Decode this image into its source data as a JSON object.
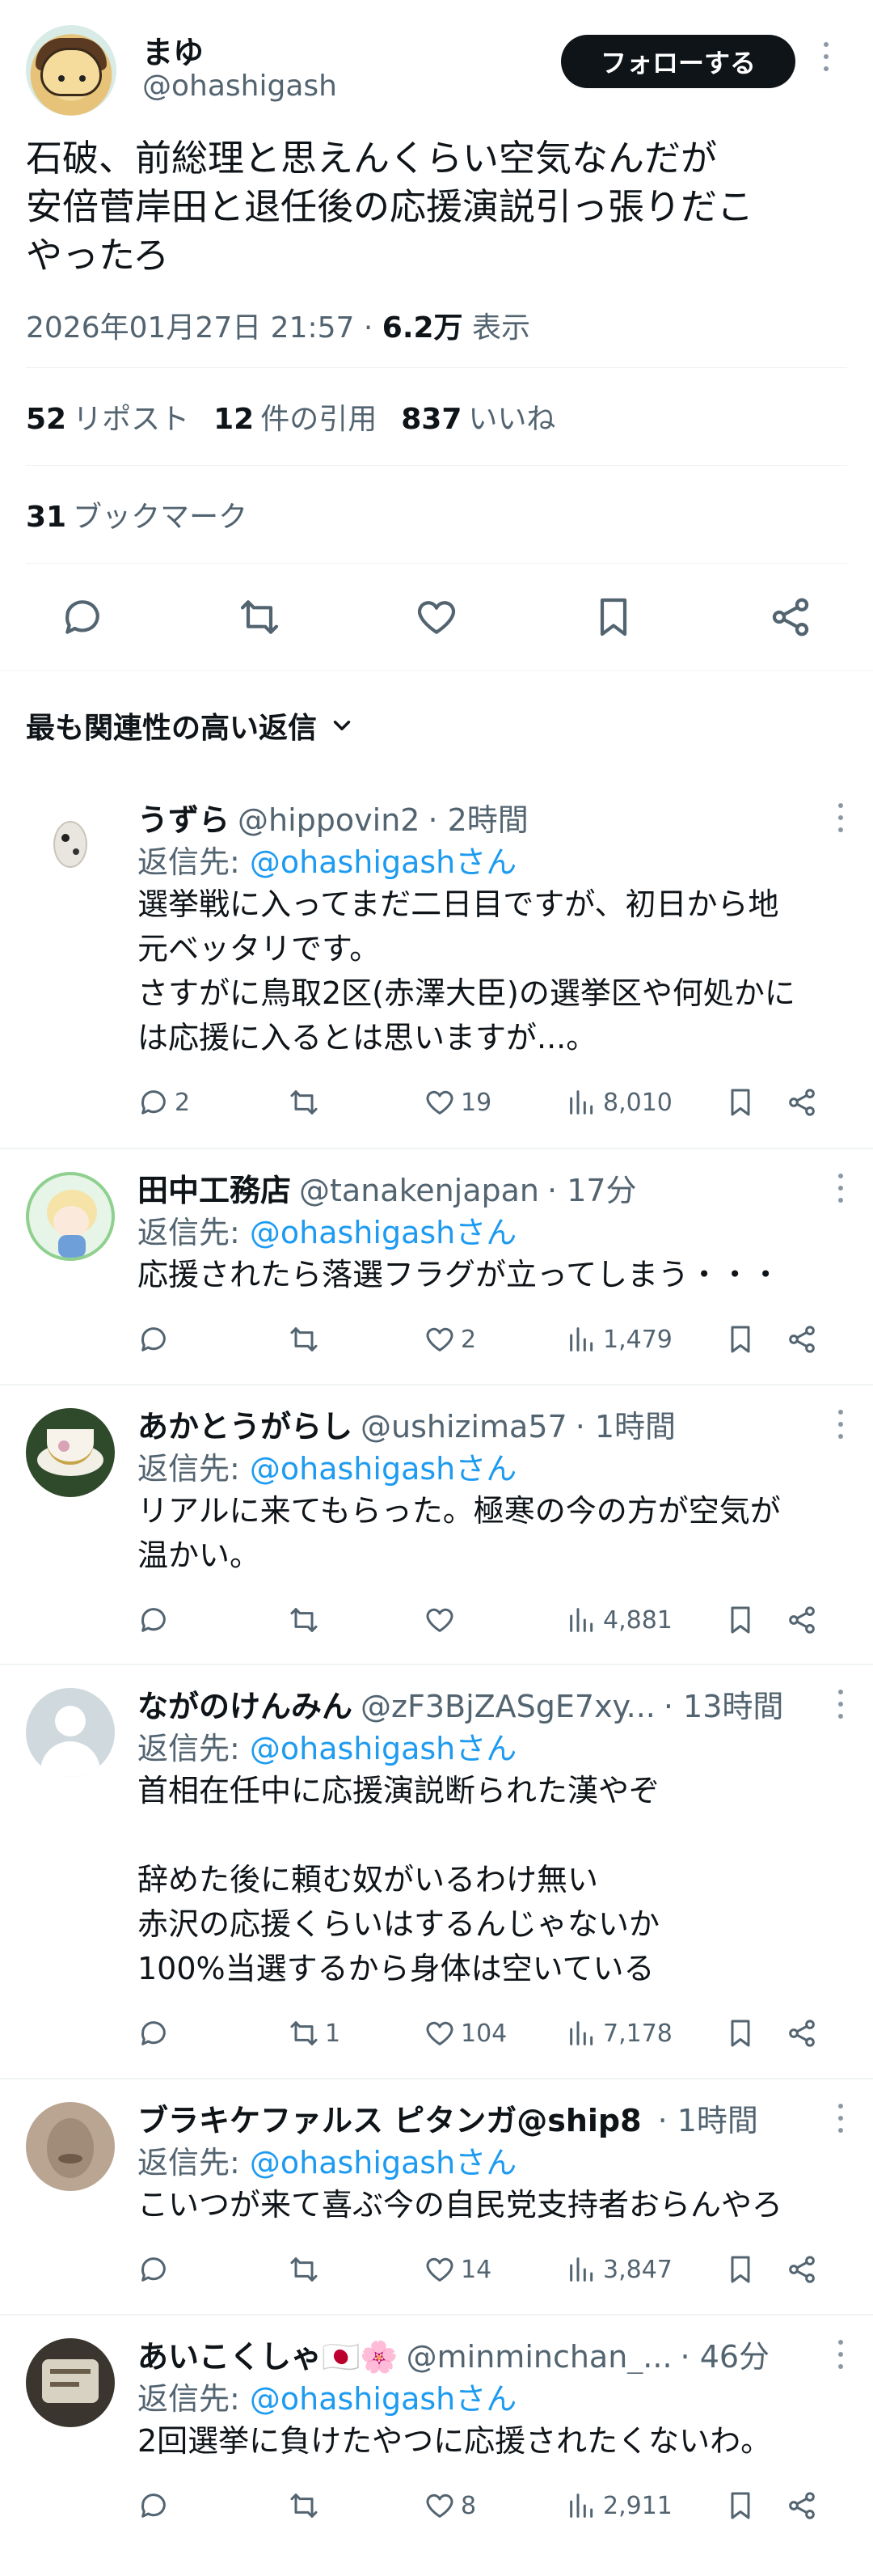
{
  "main_post": {
    "author_name": "まゆ",
    "author_handle": "@ohashigash",
    "follow_label": "フォローする",
    "text": "石破、前総理と思えんくらい空気なんだが\n安倍菅岸田と退任後の応援演説引っ張りだこ\nやったろ",
    "timestamp": "2026年01月27日 21:57",
    "views_count": "6.2万",
    "views_label": "表示",
    "reposts_count": "52",
    "reposts_label": "リポスト",
    "quotes_count": "12",
    "quotes_label": "件の引用",
    "likes_count": "837",
    "likes_label": "いいね",
    "bookmarks_count": "31",
    "bookmarks_label": "ブックマーク"
  },
  "sort_label": "最も関連性の高い返信",
  "replies": [
    {
      "name": "うずら",
      "handle": "@hippovin2",
      "time": "· 2時間",
      "reply_to_prefix": "返信先: ",
      "reply_to_handle": "@ohashigashさん",
      "text": "選挙戦に入ってまだ二日目ですが、初日から地\n元ベッタリです。\nさすがに鳥取2区(赤澤大臣)の選挙区や何処かに\nは応援に入るとは思いますが...。",
      "replies": "2",
      "retweets": "",
      "likes": "19",
      "views": "8,010"
    },
    {
      "name": "田中工務店",
      "handle": "@tanakenjapan",
      "time": "· 17分",
      "reply_to_prefix": "返信先: ",
      "reply_to_handle": "@ohashigashさん",
      "text": "応援されたら落選フラグが立ってしまう・・・",
      "replies": "",
      "retweets": "",
      "likes": "2",
      "views": "1,479"
    },
    {
      "name": "あかとうがらし",
      "handle": "@ushizima57",
      "time": "· 1時間",
      "reply_to_prefix": "返信先: ",
      "reply_to_handle": "@ohashigashさん",
      "text": "リアルに来てもらった。極寒の今の方が空気が\n温かい。",
      "replies": "",
      "retweets": "",
      "likes": "",
      "views": "4,881"
    },
    {
      "name": "ながのけんみん",
      "handle": "@zF3BjZASgE7xy...",
      "time": "· 13時間",
      "reply_to_prefix": "返信先: ",
      "reply_to_handle": "@ohashigashさん",
      "text": "首相在任中に応援演説断られた漢やぞ\n\n辞めた後に頼む奴がいるわけ無い\n赤沢の応援くらいはするんじゃないか\n100%当選するから身体は空いている",
      "replies": "",
      "retweets": "1",
      "likes": "104",
      "views": "7,178"
    },
    {
      "name": "ブラキケファルス ピタンガ@ship8",
      "handle": "",
      "time": "· 1時間",
      "reply_to_prefix": "返信先: ",
      "reply_to_handle": "@ohashigashさん",
      "text": "こいつが来て喜ぶ今の自民党支持者おらんやろ",
      "replies": "",
      "retweets": "",
      "likes": "14",
      "views": "3,847"
    },
    {
      "name": "あいこくしゃ🇯🇵🌸",
      "handle": "@minminchan_...",
      "time": "· 46分",
      "reply_to_prefix": "返信先: ",
      "reply_to_handle": "@ohashigashさん",
      "text": "2回選挙に負けたやつに応援されたくないわ。",
      "replies": "",
      "retweets": "",
      "likes": "8",
      "views": "2,911"
    }
  ],
  "colors": {
    "text": "#0f1419",
    "muted": "#536471",
    "link": "#1d9bf0",
    "divider": "#eff3f4"
  }
}
